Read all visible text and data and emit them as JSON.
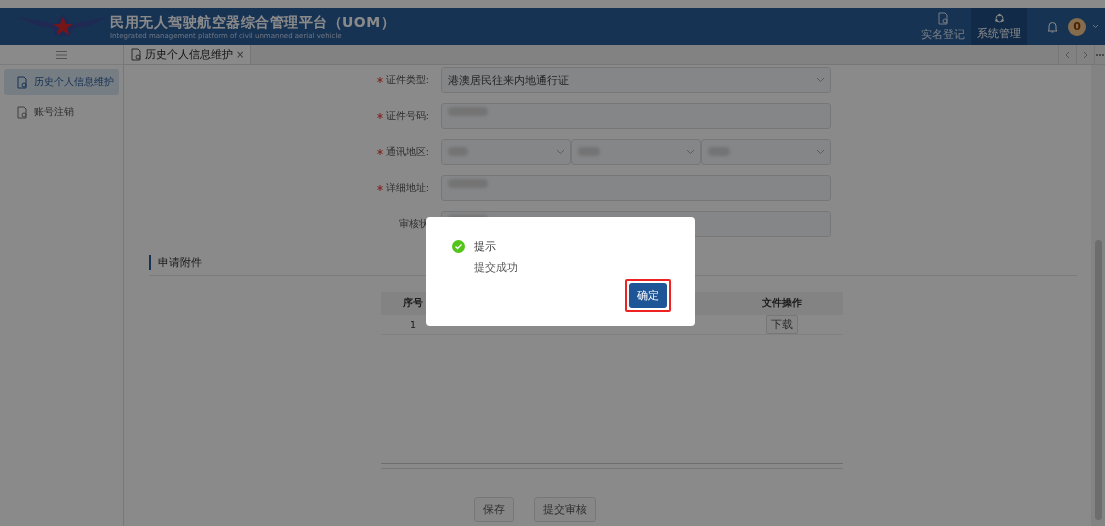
{
  "header": {
    "title": "民用无人驾驶航空器综合管理平台（UOM）",
    "subtitle": "Integrated management platform of civil unmanned aerial vehicle",
    "nav": [
      {
        "label": "实名登记",
        "selected": false
      },
      {
        "label": "系统管理",
        "selected": true
      }
    ],
    "notification_count": "0"
  },
  "sidebar": {
    "items": [
      {
        "label": "历史个人信息维护",
        "selected": true
      },
      {
        "label": "账号注销",
        "selected": false
      }
    ]
  },
  "tabs": [
    {
      "label": "历史个人信息维护",
      "selected": true,
      "close": "×"
    }
  ],
  "form": {
    "fields": [
      {
        "label": "证件类型:",
        "required": true,
        "kind": "select",
        "value": "港澳居民往来内地通行证"
      },
      {
        "label": "证件号码:",
        "required": true,
        "kind": "redacted"
      },
      {
        "label": "通讯地区:",
        "required": true,
        "kind": "region"
      },
      {
        "label": "详细地址:",
        "required": true,
        "kind": "redacted"
      },
      {
        "label": "审核状",
        "required": false,
        "kind": "redacted"
      }
    ]
  },
  "attachments": {
    "title": "申请附件",
    "columns": [
      "序号",
      "文件操作"
    ],
    "rows": [
      {
        "index": "1",
        "action": "下载"
      }
    ]
  },
  "buttons": [
    "保存",
    "提交审核"
  ],
  "dialog": {
    "title": "提示",
    "message": "提交成功",
    "confirm": "确定",
    "highlighted": true
  }
}
